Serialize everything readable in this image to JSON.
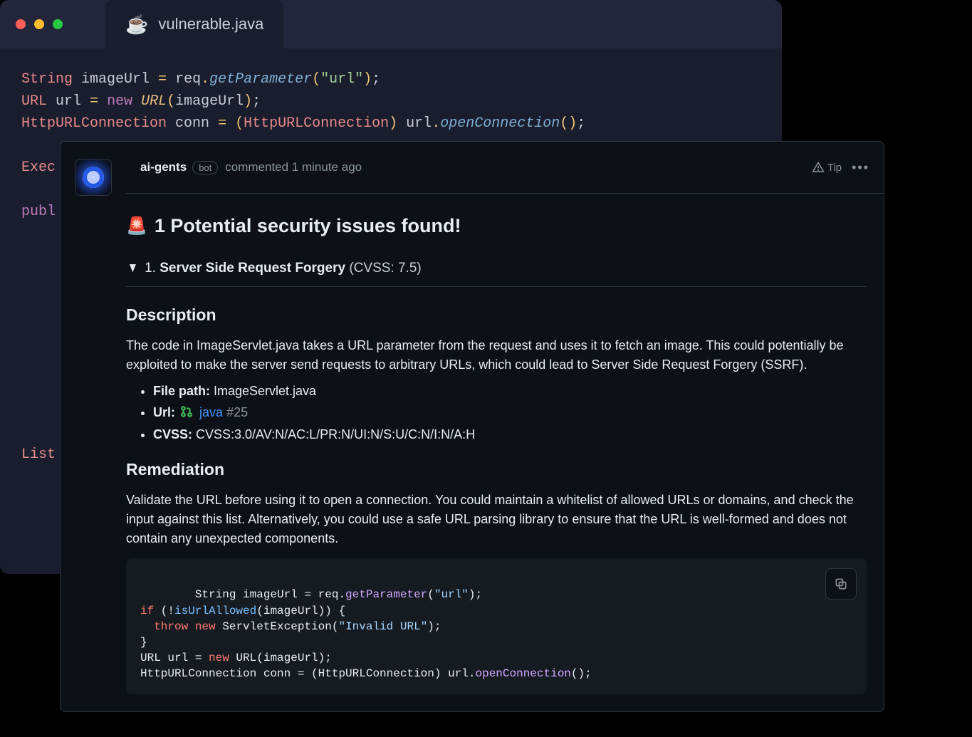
{
  "tab": {
    "filename": "vulnerable.java",
    "icon": "☕"
  },
  "editor_code": {
    "line1": {
      "t1": "String",
      "t2": " imageUrl ",
      "t3": "=",
      "t4": " req",
      "t5": ".",
      "t6": "getParameter",
      "t7": "(",
      "t8": "\"url\"",
      "t9": ")",
      "t10": ";"
    },
    "line2": {
      "t1": "URL",
      "t2": " url ",
      "t3": "=",
      "t4": " ",
      "t5": "new",
      "t6": " ",
      "t7": "URL",
      "t8": "(",
      "t9": "imageUrl",
      "t10": ")",
      "t11": ";"
    },
    "line3": {
      "t1": "HttpURLConnection",
      "t2": " conn ",
      "t3": "=",
      "t4": " ",
      "t5": "(",
      "t6": "HttpURLConnection",
      "t7": ")",
      "t8": " url",
      "t9": ".",
      "t10": "openConnection",
      "t11": "(",
      "t12": ")",
      "t13": ";"
    },
    "line5": "Exec",
    "line7": "publ",
    "line_bottom": "List"
  },
  "comment": {
    "author": "ai-gents",
    "bot_label": "bot",
    "meta": "commented 1 minute ago",
    "tip_label": "Tip",
    "heading_icon": "🚨",
    "heading": "1 Potential security issues found!",
    "disclosure_num": "1.",
    "disclosure_title": "Server Side Request Forgery",
    "disclosure_cvss": " (CVSS: 7.5)",
    "h2_description": "Description",
    "description": "The code in ImageServlet.java takes a URL parameter from the request and uses it to fetch an image. This could potentially be exploited to make the server send requests to arbitrary URLs, which could lead to Server Side Request Forgery (SSRF).",
    "list": {
      "file_path_label": "File path:",
      "file_path_value": " ImageServlet.java",
      "url_label": "Url:",
      "url_link": "java",
      "url_pr": " #25",
      "cvss_label": "CVSS:",
      "cvss_value": " CVSS:3.0/AV:N/AC:L/PR:N/UI:N/S:U/C:N/I:N/A:H"
    },
    "h2_remediation": "Remediation",
    "remediation": "Validate the URL before using it to open a connection. You could maintain a whitelist of allowed URLs or domains, and check the input against this list. Alternatively, you could use a safe URL parsing library to ensure that the URL is well-formed and does not contain any unexpected components."
  },
  "snippet": {
    "l1a": "String imageUrl = req.",
    "l1b": "getParameter",
    "l1c": "(",
    "l1d": "\"url\"",
    "l1e": ");",
    "l2a": "if",
    "l2b": " (!",
    "l2c": "isUrlAllowed",
    "l2d": "(imageUrl)) {",
    "l3a": "  ",
    "l3b": "throw",
    "l3c": " ",
    "l3d": "new",
    "l3e": " ServletException(",
    "l3f": "\"Invalid URL\"",
    "l3g": ");",
    "l4": "}",
    "l5a": "URL url = ",
    "l5b": "new",
    "l5c": " URL(imageUrl);",
    "l6a": "HttpURLConnection conn = (HttpURLConnection) url.",
    "l6b": "openConnection",
    "l6c": "();"
  }
}
